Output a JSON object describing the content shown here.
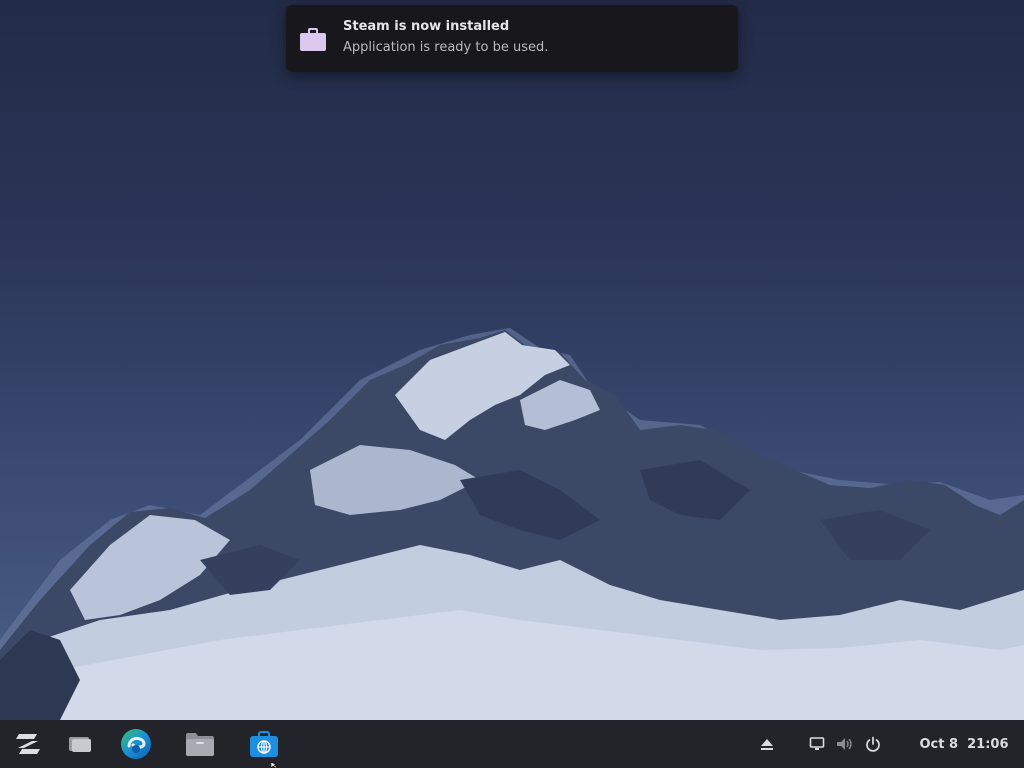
{
  "notification": {
    "title": "Steam is now installed",
    "body": "Application is ready to be used.",
    "icon": "briefcase-icon"
  },
  "taskbar": {
    "apps": [
      {
        "name": "Zorin menu",
        "icon": "zorin-logo-icon"
      },
      {
        "name": "Workspaces",
        "icon": "workspaces-icon"
      },
      {
        "name": "Microsoft Edge",
        "icon": "edge-browser-icon"
      },
      {
        "name": "Files",
        "icon": "files-folder-icon"
      },
      {
        "name": "Software",
        "icon": "software-store-icon"
      }
    ],
    "tray": [
      "eject-icon",
      "display-icon",
      "volume-icon",
      "power-icon"
    ],
    "clock": {
      "date": "Oct 8",
      "time": "21:06"
    }
  },
  "colors": {
    "taskbar_bg": "#23232a",
    "notification_bg": "#18181c",
    "briefcase": "#dcc8ef",
    "edge_blue": "#1c8fd6",
    "edge_green": "#37c26a",
    "store_blue": "#1e8fe0"
  }
}
